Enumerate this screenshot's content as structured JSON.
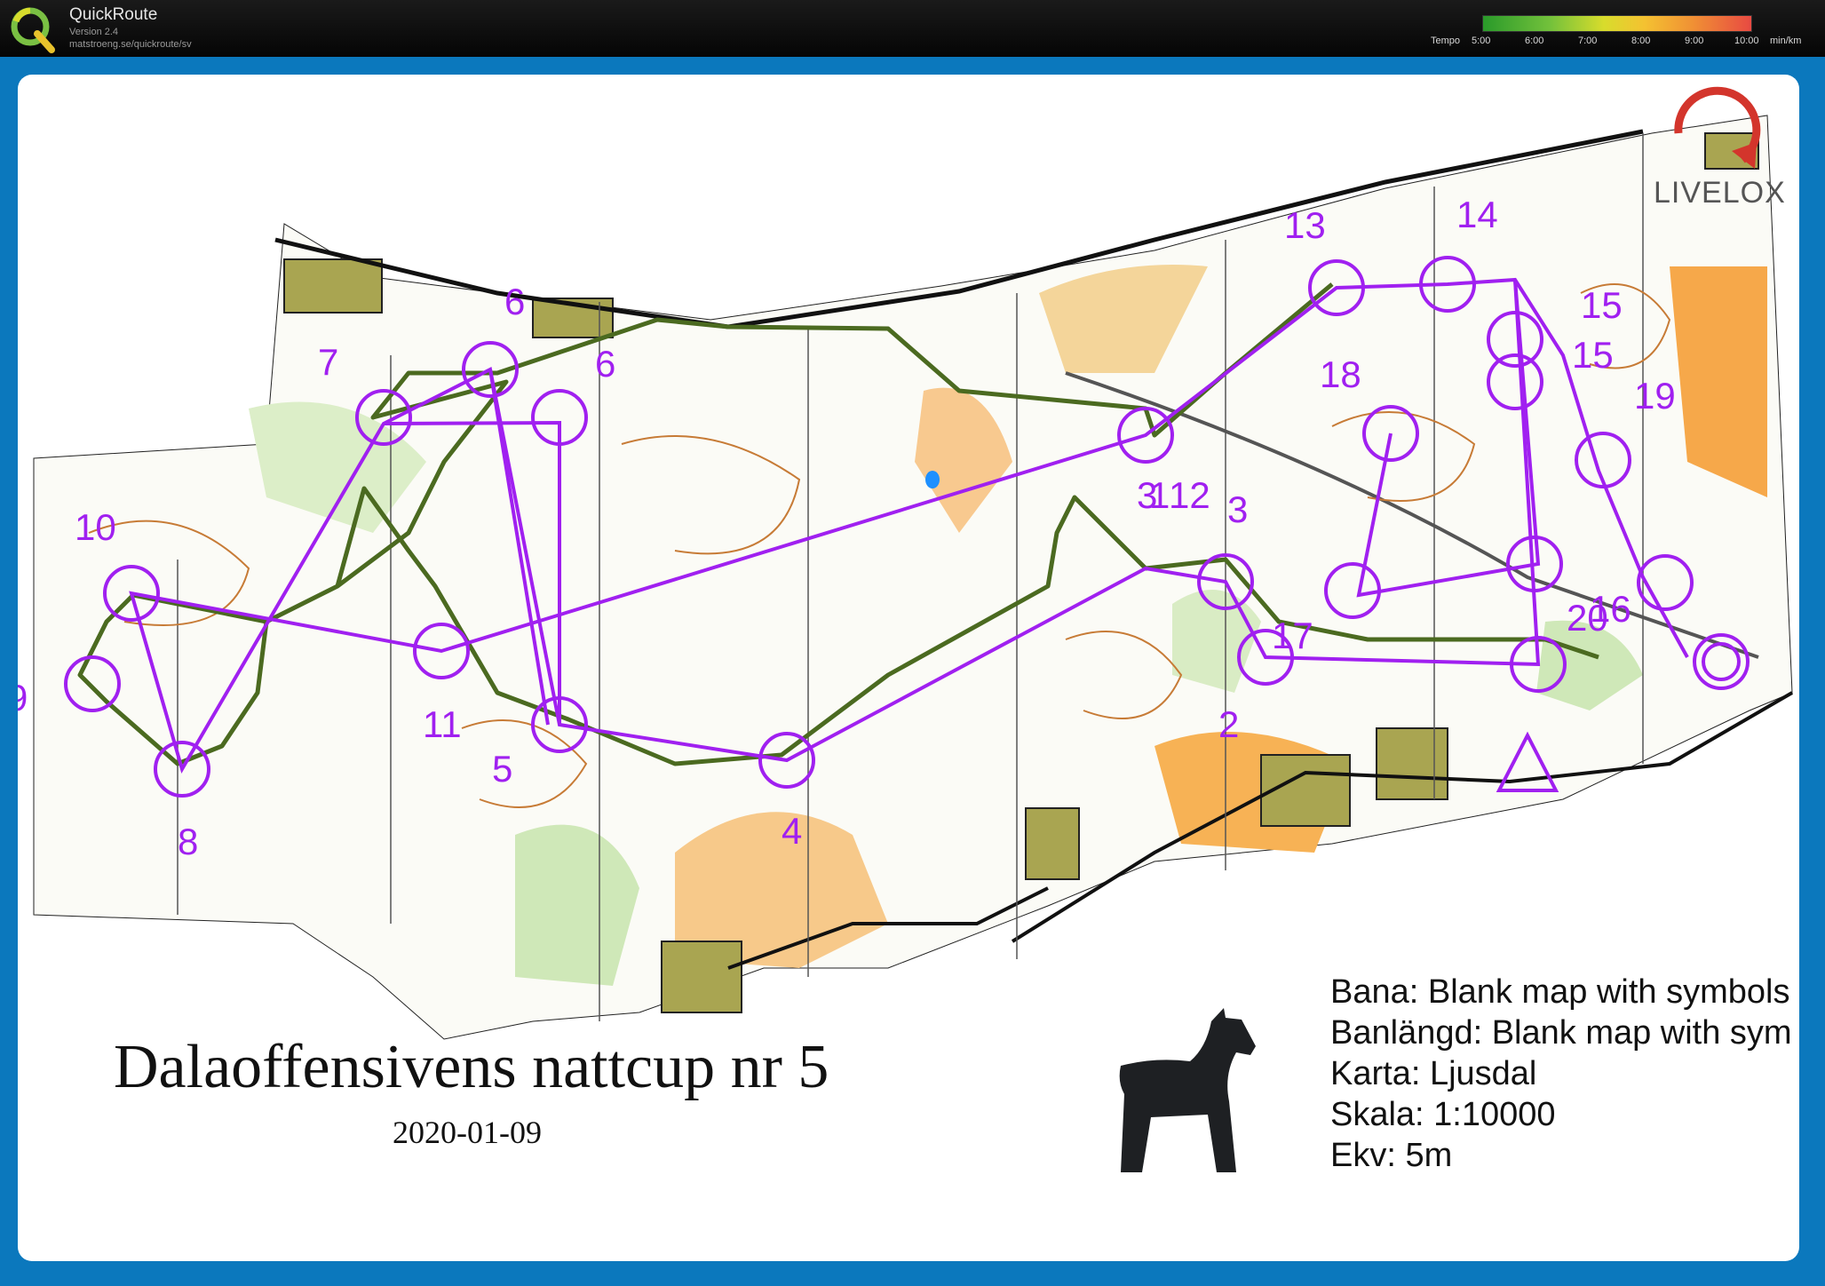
{
  "app": {
    "name": "QuickRoute",
    "version": "Version 2.4",
    "url": "matstroeng.se/quickroute/sv"
  },
  "pace_legend": {
    "label": "Tempo",
    "ticks": [
      "5:00",
      "6:00",
      "7:00",
      "8:00",
      "9:00",
      "10:00"
    ],
    "unit": "min/km",
    "colors": [
      "#2a9a2a",
      "#73c13b",
      "#d8dc2c",
      "#f4c231",
      "#f09134",
      "#e84a42"
    ]
  },
  "map": {
    "title": "Dalaoffensivens nattcup nr 5",
    "date": "2020-01-09",
    "brand": "LIVELOX",
    "course_color": "#a020f0",
    "controls": [
      {
        "id": "start"
      },
      {
        "id": "1"
      },
      {
        "id": "2"
      },
      {
        "id": "3"
      },
      {
        "id": "4"
      },
      {
        "id": "5"
      },
      {
        "id": "6"
      },
      {
        "id": "7"
      },
      {
        "id": "8"
      },
      {
        "id": "9"
      },
      {
        "id": "10"
      },
      {
        "id": "11"
      },
      {
        "id": "12"
      },
      {
        "id": "13"
      },
      {
        "id": "14"
      },
      {
        "id": "15"
      },
      {
        "id": "16"
      },
      {
        "id": "17"
      },
      {
        "id": "18"
      },
      {
        "id": "19"
      },
      {
        "id": "20"
      }
    ],
    "info": {
      "bana": "Bana: Blank map with symbols",
      "banlangd": "Banlängd: Blank map with sym",
      "karta": "Karta: Ljusdal",
      "skala": "Skala: 1:10000",
      "ekv": "Ekv: 5m"
    }
  }
}
